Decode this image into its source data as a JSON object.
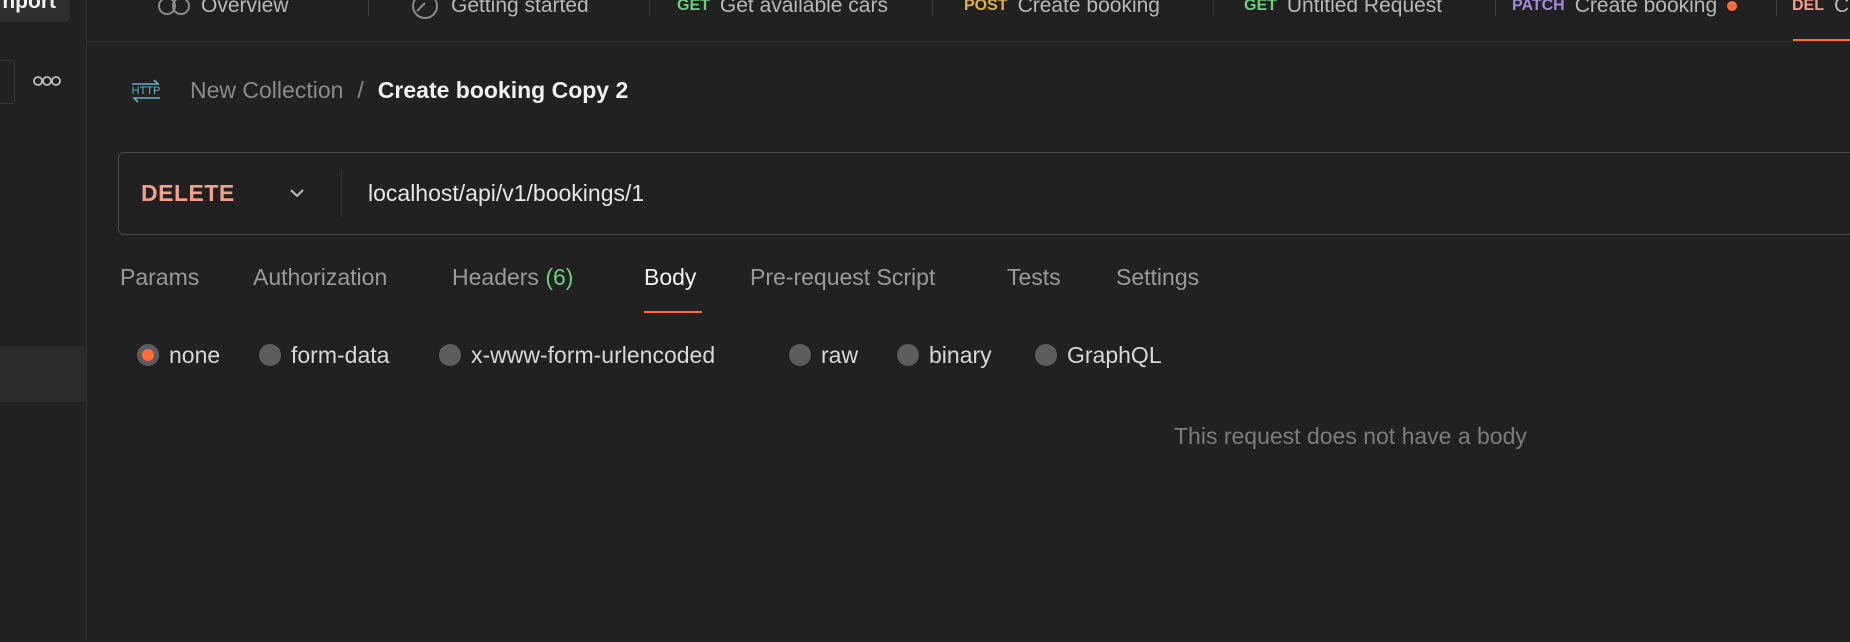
{
  "sidebar": {
    "import_label": "nport"
  },
  "tabs": [
    {
      "method": "",
      "title": "Overview"
    },
    {
      "method": "",
      "title": "Getting started"
    },
    {
      "method": "GET",
      "title": "Get available cars"
    },
    {
      "method": "POST",
      "title": "Create booking"
    },
    {
      "method": "GET",
      "title": "Untitled Request"
    },
    {
      "method": "PATCH",
      "title": "Create booking"
    },
    {
      "method": "DEL",
      "title": "C"
    }
  ],
  "breadcrumb": {
    "collection": "New Collection",
    "separator": "/",
    "title": "Create booking Copy 2"
  },
  "request": {
    "method": "DELETE",
    "url": "localhost/api/v1/bookings/1"
  },
  "request_tabs": {
    "params": "Params",
    "authorization": "Authorization",
    "headers": "Headers",
    "headers_count": "(6)",
    "body": "Body",
    "prerequest": "Pre-request Script",
    "tests": "Tests",
    "settings": "Settings"
  },
  "body_types": {
    "none": "none",
    "form_data": "form-data",
    "urlencoded": "x-www-form-urlencoded",
    "raw": "raw",
    "binary": "binary",
    "graphql": "GraphQL",
    "selected": "none"
  },
  "body_empty_message": "This request does not have a body",
  "colors": {
    "accent": "#ff6c37",
    "get": "#6fcf7f",
    "post": "#e3b341",
    "patch": "#a58ad6",
    "delete": "#f0a08c"
  }
}
